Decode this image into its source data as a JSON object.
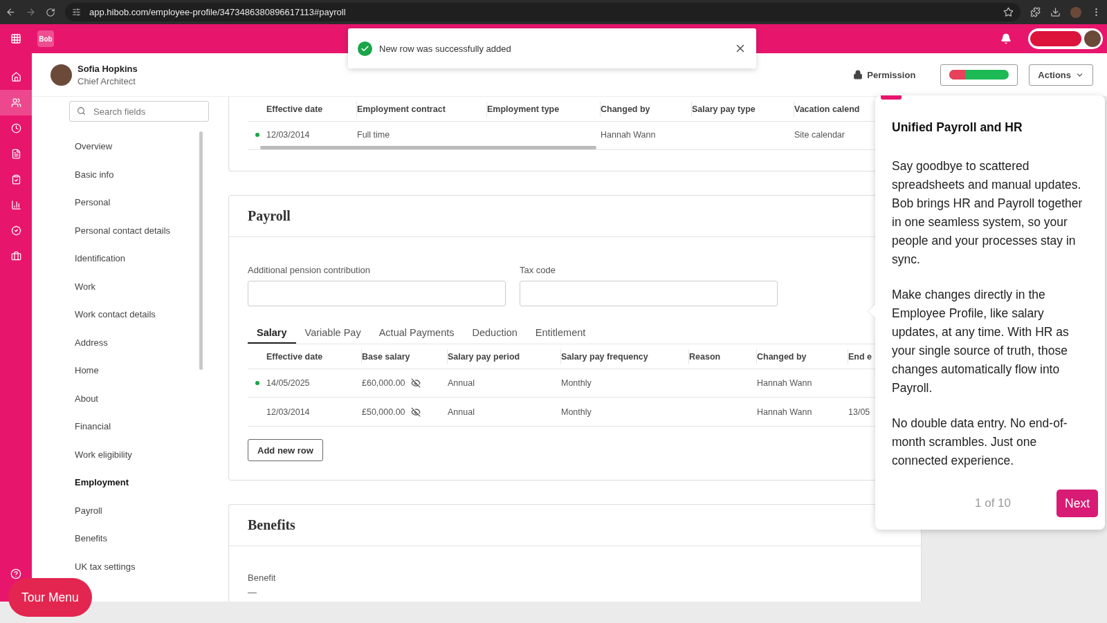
{
  "browser": {
    "url": "app.hibob.com/employee-profile/3473486380896617113#payroll"
  },
  "topbar": {
    "logo": "Bob"
  },
  "rail": {
    "items": [
      {
        "selected": false
      },
      {
        "selected": true
      },
      {
        "selected": false
      },
      {
        "selected": false
      },
      {
        "selected": false
      },
      {
        "selected": false
      },
      {
        "selected": false
      },
      {
        "selected": false
      }
    ]
  },
  "toast": {
    "message": "New row was successfully added"
  },
  "profile": {
    "name": "Sofia Hopkins",
    "title": "Chief Architect",
    "permission": "Permission",
    "actions": "Actions"
  },
  "sidebar": {
    "search_placeholder": "Search fields",
    "items": [
      {
        "label": "Overview",
        "selected": false
      },
      {
        "label": "Basic info",
        "selected": false
      },
      {
        "label": "Personal",
        "selected": false
      },
      {
        "label": "Personal contact details",
        "selected": false
      },
      {
        "label": "Identification",
        "selected": false
      },
      {
        "label": "Work",
        "selected": false
      },
      {
        "label": "Work contact details",
        "selected": false
      },
      {
        "label": "Address",
        "selected": false
      },
      {
        "label": "Home",
        "selected": false
      },
      {
        "label": "About",
        "selected": false
      },
      {
        "label": "Financial",
        "selected": false
      },
      {
        "label": "Work eligibility",
        "selected": false
      },
      {
        "label": "Employment",
        "selected": true
      },
      {
        "label": "Payroll",
        "selected": false
      },
      {
        "label": "Benefits",
        "selected": false
      },
      {
        "label": "UK tax settings",
        "selected": false
      }
    ]
  },
  "employment_table": {
    "columns": [
      "Effective date",
      "Employment contract",
      "Employment type",
      "Changed by",
      "Salary pay type",
      "Vacation calend"
    ],
    "rows": [
      {
        "current": true,
        "cells": [
          "12/03/2014",
          "Full time",
          "",
          "Hannah Wann",
          "",
          "Site calendar"
        ]
      }
    ]
  },
  "payroll": {
    "title": "Payroll",
    "fields": [
      {
        "label": "Additional pension contribution"
      },
      {
        "label": "Tax code"
      }
    ],
    "tabs": [
      {
        "label": "Salary",
        "selected": true
      },
      {
        "label": "Variable Pay",
        "selected": false
      },
      {
        "label": "Actual Payments",
        "selected": false
      },
      {
        "label": "Deduction",
        "selected": false
      },
      {
        "label": "Entitlement",
        "selected": false
      }
    ],
    "table": {
      "columns": [
        "Effective date",
        "Base salary",
        "Salary pay period",
        "Salary pay frequency",
        "Reason",
        "Changed by",
        "End e"
      ],
      "rows": [
        {
          "current": true,
          "hidden_salary": true,
          "cells": [
            "14/05/2025",
            "£60,000.00",
            "Annual",
            "Monthly",
            "",
            "Hannah Wann",
            ""
          ]
        },
        {
          "current": false,
          "hidden_salary": true,
          "cells": [
            "12/03/2014",
            "£50,000.00",
            "Annual",
            "Monthly",
            "",
            "Hannah Wann",
            "13/05"
          ]
        }
      ]
    },
    "add_button": "Add new row"
  },
  "benefits": {
    "title": "Benefits",
    "field_label": "Benefit",
    "field_value": "—"
  },
  "tour": {
    "title": "Unified Payroll and HR",
    "paragraphs": [
      "Say goodbye to scattered spreadsheets and manual updates. Bob brings HR and Payroll together in one seamless system, so your people and your processes stay in sync.",
      "Make changes directly in the Employee Profile, like salary updates, at any time. With HR as your single source of truth, those changes automatically flow into Payroll.",
      "No double data entry. No end-of-month scrambles. Just one connected experience."
    ],
    "counter": "1 of 10",
    "next": "Next"
  },
  "tour_menu": "Tour Menu"
}
